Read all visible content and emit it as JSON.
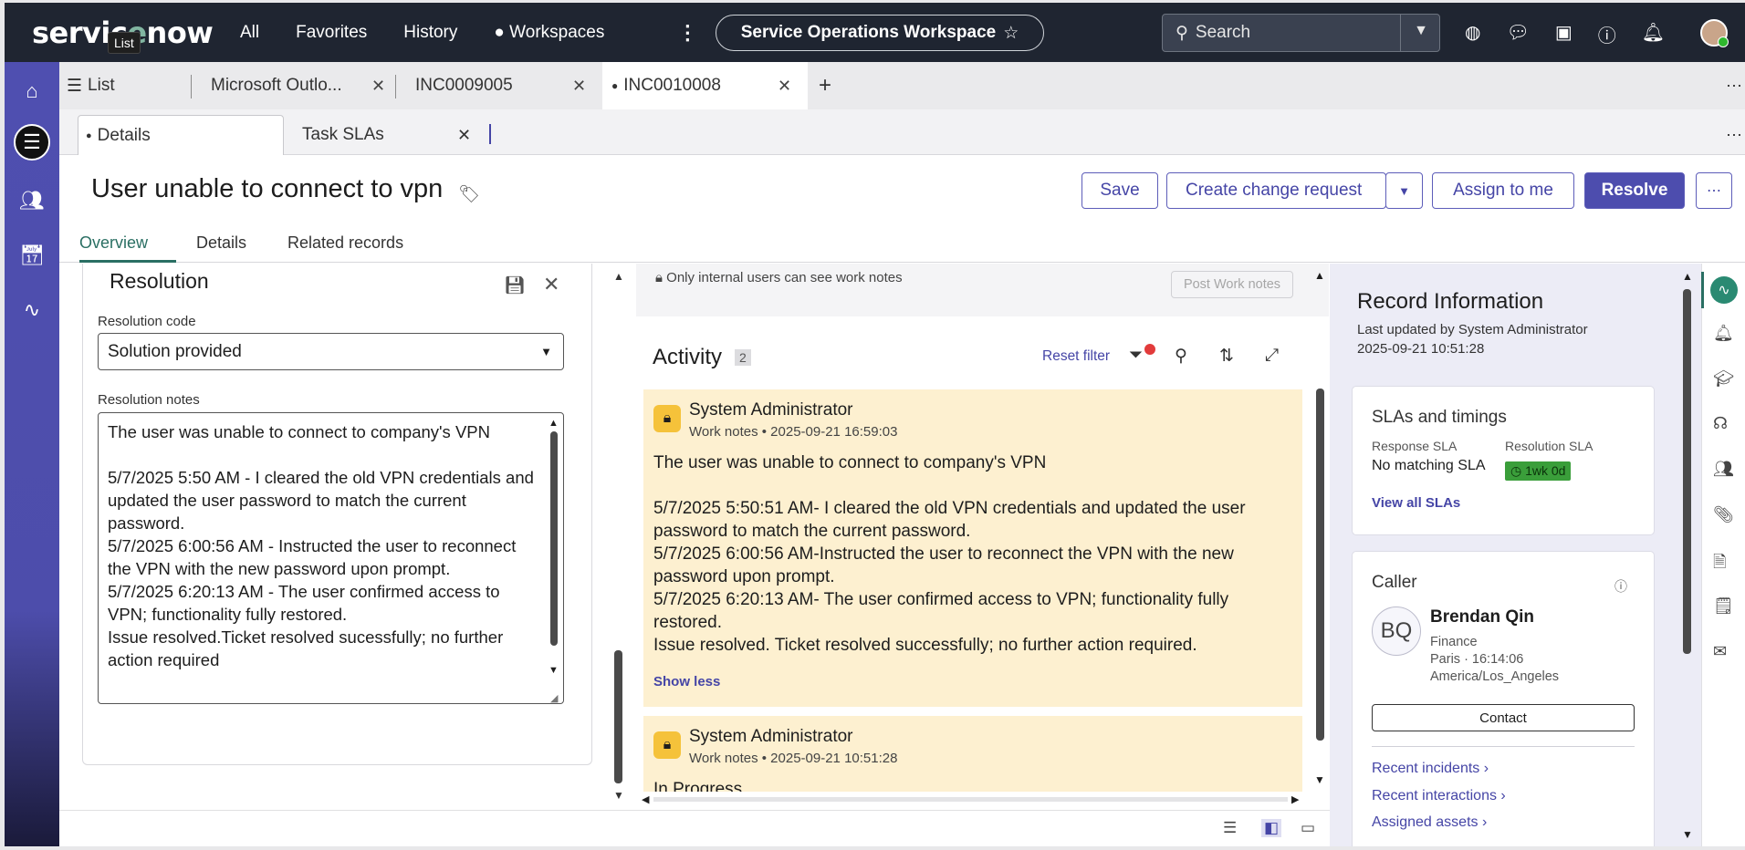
{
  "app": {
    "logo_text": "servicenow",
    "logo_tooltip": "List",
    "nav": [
      "All",
      "Favorites",
      "History",
      "Workspaces"
    ],
    "workspace_title": "Service Operations Workspace",
    "search_placeholder": "Search"
  },
  "tabs": [
    {
      "label": "List"
    },
    {
      "label": "Microsoft Outlo..."
    },
    {
      "label": "INC0009005"
    },
    {
      "label": "INC0010008"
    }
  ],
  "subtabs_top": [
    {
      "label": "Details"
    },
    {
      "label": "Task SLAs"
    }
  ],
  "record": {
    "title": "User unable to connect to vpn",
    "buttons": {
      "save": "Save",
      "create_change": "Create change request",
      "assign": "Assign to me",
      "resolve": "Resolve"
    },
    "view_tabs": [
      "Overview",
      "Details",
      "Related records"
    ]
  },
  "resolution": {
    "title": "Resolution",
    "code_label": "Resolution code",
    "code_value": "Solution provided",
    "notes_label": "Resolution notes",
    "notes_value": "The user was unable to connect to company's VPN\n\n5/7/2025 5:50 AM - I cleared the old VPN credentials and updated the user password to match the current password.\n5/7/2025 6:00:56 AM - Instructed the user to reconnect the VPN with the new password upon prompt.\n5/7/2025 6:20:13 AM - The user confirmed access to VPN; functionality fully restored.\nIssue resolved.Ticket resolved sucessfully; no further action required"
  },
  "activity": {
    "notes_notice": "Only internal users can see work notes",
    "post_button": "Post Work notes",
    "title": "Activity",
    "count": "2",
    "reset_filter": "Reset filter",
    "entries": [
      {
        "author": "System Administrator",
        "meta": "Work notes • 2025-09-21 16:59:03",
        "body": "The user was unable to connect to company's VPN\n\n5/7/2025 5:50:51 AM- I cleared the old VPN credentials and updated the user password to match the current password.\n5/7/2025 6:00:56 AM-Instructed the user to reconnect the VPN with the new password upon prompt.\n5/7/2025 6:20:13 AM- The user confirmed access to VPN; functionality fully restored.\nIssue resolved. Ticket resolved successfully; no further action required.",
        "toggle": "Show less"
      },
      {
        "author": "System Administrator",
        "meta": "Work notes • 2025-09-21 10:51:28",
        "body": "In Progress"
      }
    ]
  },
  "record_info": {
    "title": "Record Information",
    "updated_by": "Last updated by System Administrator",
    "updated_at": "2025-09-21 10:51:28",
    "sla": {
      "title": "SLAs and timings",
      "response_label": "Response SLA",
      "response_value": "No matching SLA",
      "resolution_label": "Resolution SLA",
      "resolution_value": "1wk 0d",
      "view_all": "View all SLAs"
    },
    "caller": {
      "title": "Caller",
      "initials": "BQ",
      "name": "Brendan Qin",
      "department": "Finance",
      "location_time": "Paris · 16:14:06",
      "timezone": "America/Los_Angeles",
      "contact_button": "Contact",
      "links": [
        "Recent incidents",
        "Recent interactions",
        "Assigned assets"
      ]
    }
  },
  "colors": {
    "topbar": "#1f2531",
    "rail": "#4f4fb0",
    "primary": "#4d4dae",
    "note_card": "#fdf0d0",
    "sla_green": "#3a9e3a"
  }
}
